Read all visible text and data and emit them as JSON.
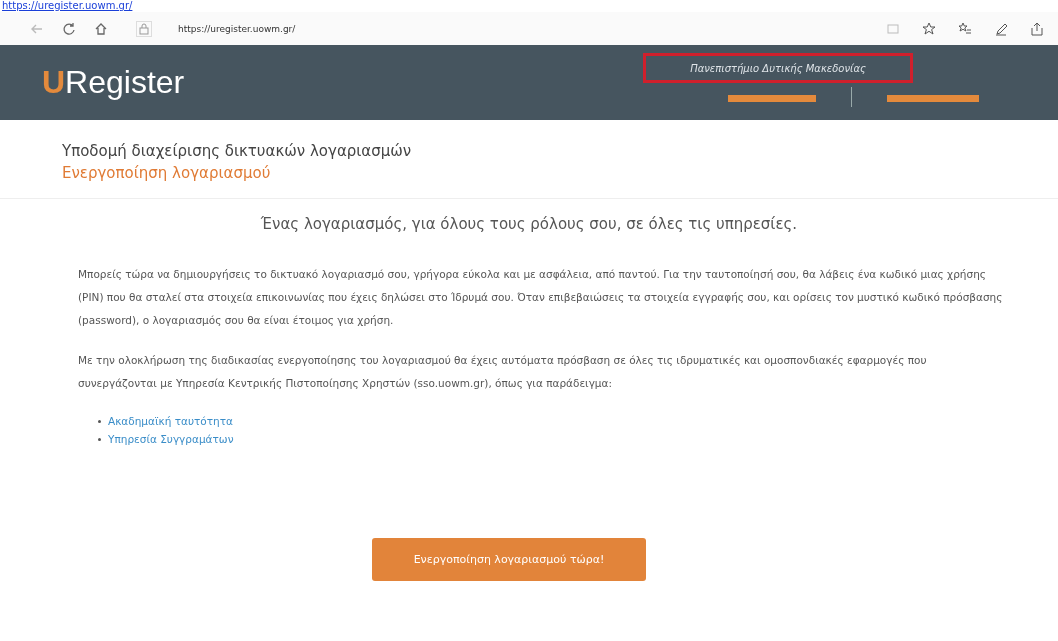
{
  "top_link": "https://uregister.uowm.gr/",
  "browser": {
    "address": "https://uregister.uowm.gr/"
  },
  "header": {
    "logo_initial": "U",
    "logo_rest": "Register",
    "institution": "Πανεπιστήμιο Δυτικής Μακεδονίας",
    "highlighted": true
  },
  "page_title": "Υποδομή διαχείρισης δικτυακών λογαριασμών",
  "page_subtitle": "Ενεργοποίηση λογαριασμού",
  "tagline": "Ένας λογαριασμός, για όλους τους ρόλους σου, σε όλες τις υπηρεσίες.",
  "paragraphs": [
    "Μπορείς τώρα να δημιουργήσεις το δικτυακό λογαριασμό σου, γρήγορα εύκολα και με ασφάλεια, από παντού. Για την ταυτοποίησή σου, θα λάβεις ένα κωδικό μιας χρήσης (PIN) που θα σταλεί στα στοιχεία επικοινωνίας που έχεις δηλώσει στο Ίδρυμά σου. Όταν επιβεβαιώσεις τα στοιχεία εγγραφής σου, και ορίσεις τον μυστικό κωδικό πρόσβασης (password), ο λογαριασμός σου θα είναι έτοιμος για χρήση.",
    "Με την ολοκλήρωση της διαδικασίας ενεργοποίησης του λογαριασμού θα έχεις αυτόματα πρόσβαση σε όλες τις ιδρυματικές και ομοσπονδιακές εφαρμογές που συνεργάζονται με Υπηρεσία Κεντρικής Πιστοποίησης Χρηστών (sso.uowm.gr), όπως για παράδειγμα:"
  ],
  "links": [
    "Ακαδημαϊκή ταυτότητα",
    "Υπηρεσία Συγγραμάτων"
  ],
  "action_button": "Ενεργοποίηση λογαριασμού τώρα!"
}
